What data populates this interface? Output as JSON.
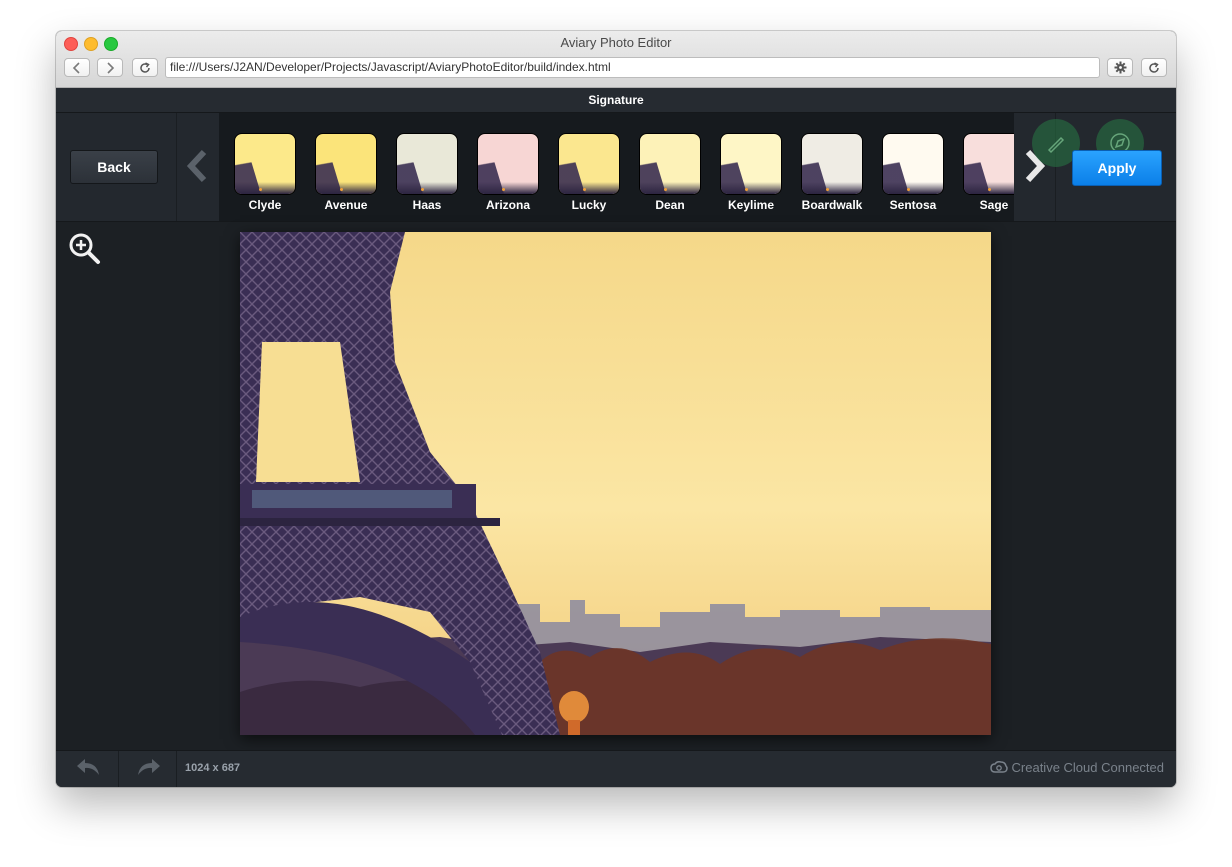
{
  "browser": {
    "title": "Aviary Photo Editor",
    "url": "file:///Users/J2AN/Developer/Projects/Javascript/AviaryPhotoEditor/build/index.html",
    "back_icon": "chevron-left-icon",
    "forward_icon": "chevron-right-icon",
    "reload_icon": "reload-icon",
    "settings_icon": "gear-icon"
  },
  "editor": {
    "panel_title": "Signature",
    "back_label": "Back",
    "apply_label": "Apply",
    "accent_color": "#0b7fe8",
    "filters": [
      {
        "label": "Clyde",
        "tint": "#fce98a"
      },
      {
        "label": "Avenue",
        "tint": "#fbe47a"
      },
      {
        "label": "Haas",
        "tint": "#e9e8d8"
      },
      {
        "label": "Arizona",
        "tint": "#f7d6d4"
      },
      {
        "label": "Lucky",
        "tint": "#fbe78f"
      },
      {
        "label": "Dean",
        "tint": "#fdf2b8"
      },
      {
        "label": "Keylime",
        "tint": "#fef6c6"
      },
      {
        "label": "Boardwalk",
        "tint": "#efece4"
      },
      {
        "label": "Sentosa",
        "tint": "#fffaf0"
      },
      {
        "label": "Sage",
        "tint": "#f8dedc"
      }
    ],
    "image_size": "1024 x 687",
    "status": "Creative Cloud Connected"
  }
}
